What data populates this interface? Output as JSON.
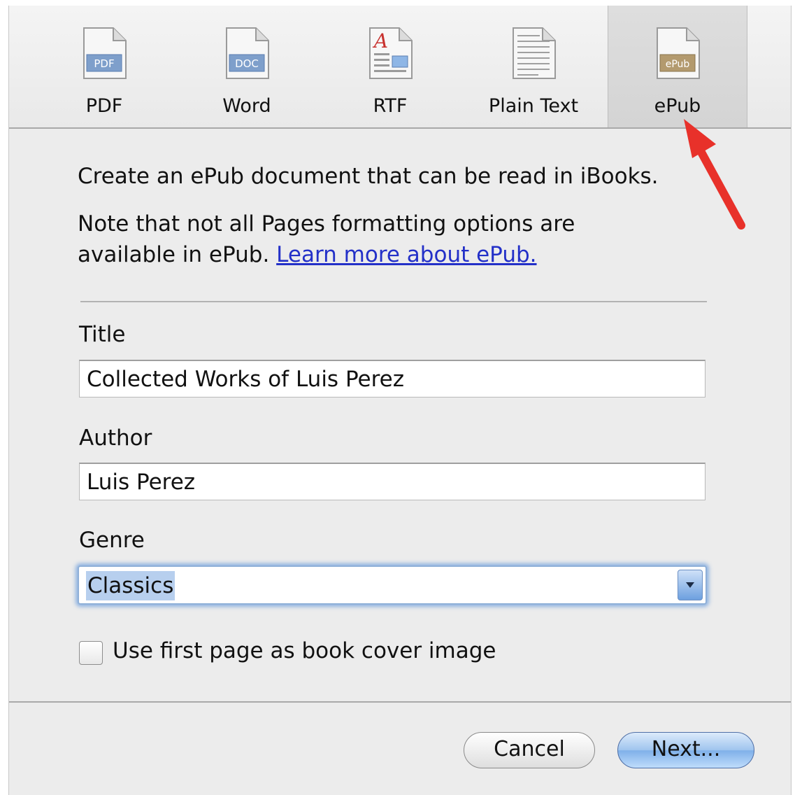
{
  "tabs": [
    {
      "label": "PDF",
      "icon": "pdf-document-icon",
      "badge": "PDF"
    },
    {
      "label": "Word",
      "icon": "word-document-icon",
      "badge": "DOC"
    },
    {
      "label": "RTF",
      "icon": "rtf-document-icon",
      "badge": "A"
    },
    {
      "label": "Plain Text",
      "icon": "plain-text-document-icon"
    },
    {
      "label": "ePub",
      "icon": "epub-document-icon",
      "badge": "ePub"
    }
  ],
  "selected_tab": "ePub",
  "description": {
    "line1": "Create an ePub document that can be read in iBooks.",
    "line2": "Note that not all Pages formatting options are",
    "line3_prefix": "available in ePub. ",
    "learn_more": "Learn more about ePub."
  },
  "form": {
    "title_label": "Title",
    "title_value": "Collected Works of Luis Perez",
    "author_label": "Author",
    "author_value": "Luis Perez",
    "genre_label": "Genre",
    "genre_value": "Classics",
    "cover_checkbox_label": "Use first page as book cover image",
    "cover_checked": false
  },
  "buttons": {
    "cancel": "Cancel",
    "next": "Next..."
  },
  "colors": {
    "link": "#2330c8",
    "annotation_arrow": "#e8312a",
    "focus_ring": "#70a0de"
  }
}
